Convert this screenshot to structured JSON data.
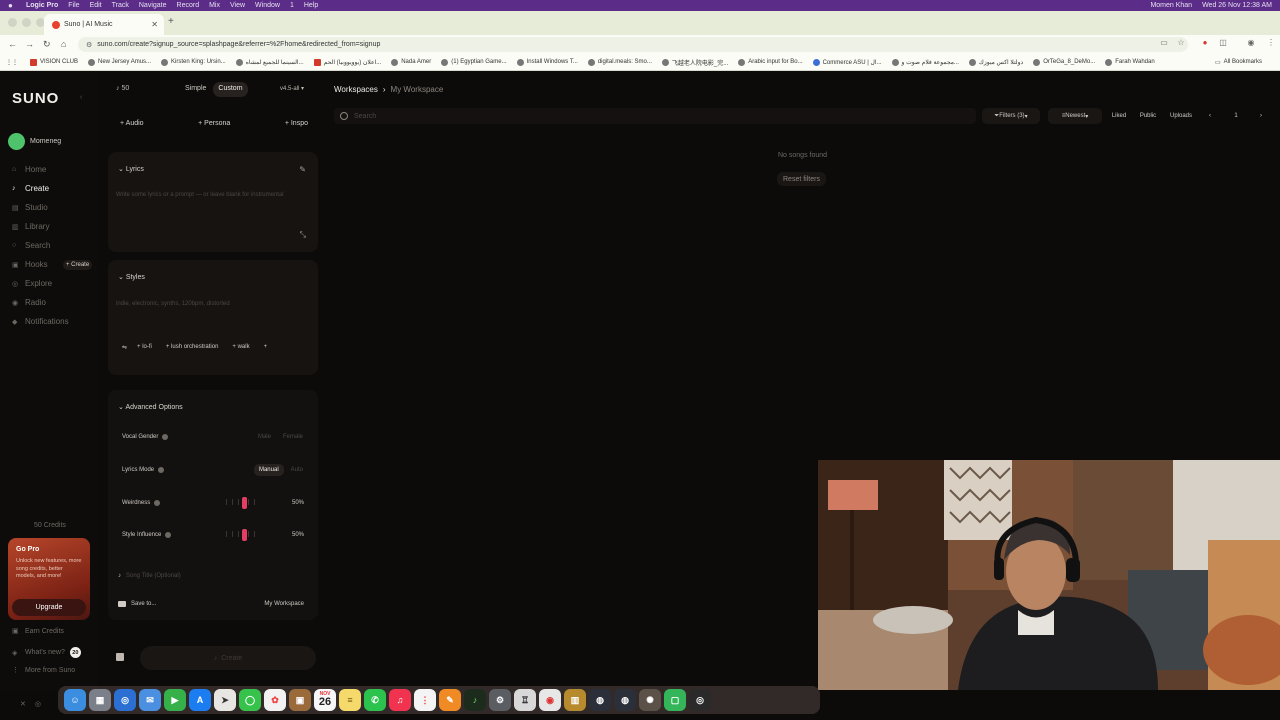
{
  "menubar": {
    "app": "Logic Pro",
    "items": [
      "File",
      "Edit",
      "Track",
      "Navigate",
      "Record",
      "Mix",
      "View",
      "Window",
      "1",
      "Help"
    ],
    "user": "Momen Khan",
    "datetime": "Wed 26 Nov 12:38 AM"
  },
  "browser": {
    "tab_title": "Suno | AI Music",
    "url": "suno.com/create?signup_source=splashpage&referrer=%2Fhome&redirected_from=signup",
    "bookmarks": [
      "VISION CLUB",
      "New Jersey Amus...",
      "Kirsten King: Ursin...",
      "السينما للجميع لمشاه...",
      "اعلان (يوويووبيا) الحم...",
      "Nada Amer",
      "(1) Egyptian Game...",
      "Install Windows T...",
      "digital.meals: Smo...",
      "飞越老人院电影_完...",
      "Arabic input for Bo...",
      "Commerce ASU | ال...",
      "مجموعة فلام صوت و...",
      "دولتلا اكس ميوزك",
      "OrTeGa_8_DeMo...",
      "Farah Wahdan"
    ],
    "all_bookmarks": "All Bookmarks"
  },
  "sidebar": {
    "logo": "SUNO",
    "user": "Momeneg",
    "nav": [
      {
        "label": "Home",
        "icon": "home-icon",
        "active": false
      },
      {
        "label": "Create",
        "icon": "create-icon",
        "active": true
      },
      {
        "label": "Studio",
        "icon": "studio-icon",
        "active": false
      },
      {
        "label": "Library",
        "icon": "library-icon",
        "active": false
      },
      {
        "label": "Search",
        "icon": "search-icon",
        "active": false
      },
      {
        "label": "Hooks",
        "icon": "hooks-icon",
        "active": false
      },
      {
        "label": "Explore",
        "icon": "explore-icon",
        "active": false
      },
      {
        "label": "Radio",
        "icon": "radio-icon",
        "active": false
      },
      {
        "label": "Notifications",
        "icon": "bell-icon",
        "active": false
      }
    ],
    "hooks_create": "+ Create",
    "credits": "50 Credits",
    "gopro": {
      "title": "Go Pro",
      "desc": "Unlock new features, more song credits, better models, and more!",
      "button": "Upgrade"
    },
    "earn": "Earn Credits",
    "whats_new": "What's new?",
    "whats_new_count": "20",
    "more": "More from Suno"
  },
  "panel": {
    "credits_short": "50",
    "mode_simple": "Simple",
    "mode_custom": "Custom",
    "model": "v4.5-all",
    "add_audio": "+ Audio",
    "add_persona": "+ Persona",
    "add_inspo": "+ Inspo",
    "lyrics_header": "Lyrics",
    "lyrics_placeholder": "Write some lyrics or a prompt — or leave blank for instrumental",
    "styles_header": "Styles",
    "styles_placeholder": "indie, electronic, synths, 120bpm, distorted",
    "style_tags": [
      "+ lo-fi",
      "+ lush orchestration",
      "+ walk",
      "+"
    ],
    "advanced_header": "Advanced Options",
    "vocal_gender": "Vocal Gender",
    "vocal_male": "Male",
    "vocal_female": "Female",
    "lyrics_mode": "Lyrics Mode",
    "lyrics_manual": "Manual",
    "lyrics_auto": "Auto",
    "weirdness": "Weirdness",
    "weirdness_value": "50%",
    "style_influence": "Style Influence",
    "style_influence_value": "50%",
    "song_title_placeholder": "Song Title (Optional)",
    "save_to": "Save to...",
    "workspace": "My Workspace",
    "create_button": "Create"
  },
  "main": {
    "crumb_root": "Workspaces",
    "crumb_current": "My Workspace",
    "search_placeholder": "Search",
    "filters": "Filters (3)",
    "sort": "Newest",
    "liked": "Liked",
    "public": "Public",
    "uploads": "Uploads",
    "page": "1",
    "empty": "No songs found",
    "reset": "Reset filters"
  },
  "dock": {
    "calendar_day": "26",
    "calendar_month": "NOV"
  },
  "colors": {
    "menubar": "#5b2d88",
    "accent": "#e33e63",
    "bg": "#0d0b0a",
    "avatar": "#4fc36b"
  }
}
